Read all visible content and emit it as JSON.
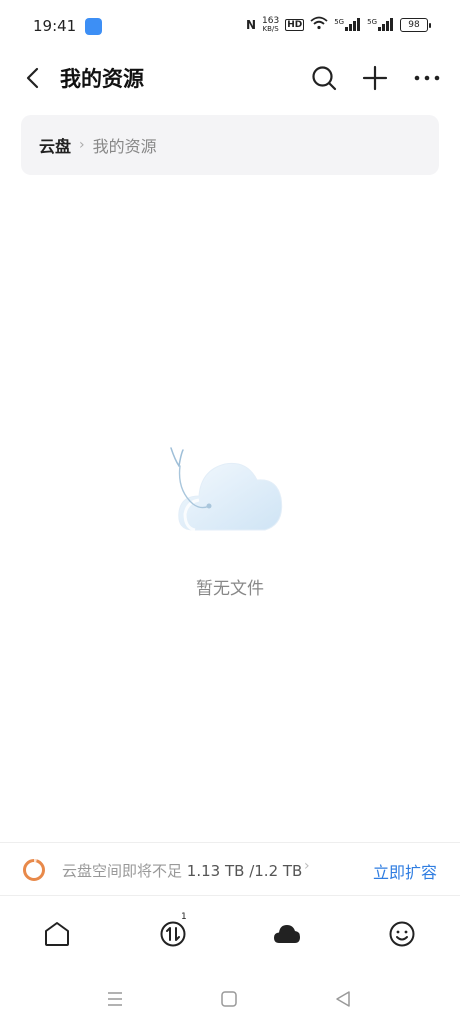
{
  "status_bar": {
    "time": "19:41",
    "net_speed_top": "163",
    "net_speed_bottom": "KB/S",
    "hd_label": "HD",
    "signal_label_1": "5G",
    "signal_label_2": "5G",
    "battery": "98"
  },
  "header": {
    "title": "我的资源"
  },
  "breadcrumb": {
    "root": "云盘",
    "separator": "›",
    "current": "我的资源"
  },
  "empty_state": {
    "text": "暂无文件"
  },
  "storage": {
    "warning": "云盘空间即将不足",
    "used": "1.13 TB",
    "total": "/1.2 TB",
    "chevron": "›",
    "expand_label": "立即扩容",
    "ring_color": "#e8894a",
    "accent_color": "#2f7de1"
  },
  "tabbar": {
    "transfer_badge": "1",
    "tabs": [
      "home-icon",
      "transfer-icon",
      "cloud-icon",
      "profile-icon"
    ]
  },
  "nav_bar": {
    "buttons": [
      "menu-icon",
      "home-square-icon",
      "back-triangle-icon"
    ]
  }
}
